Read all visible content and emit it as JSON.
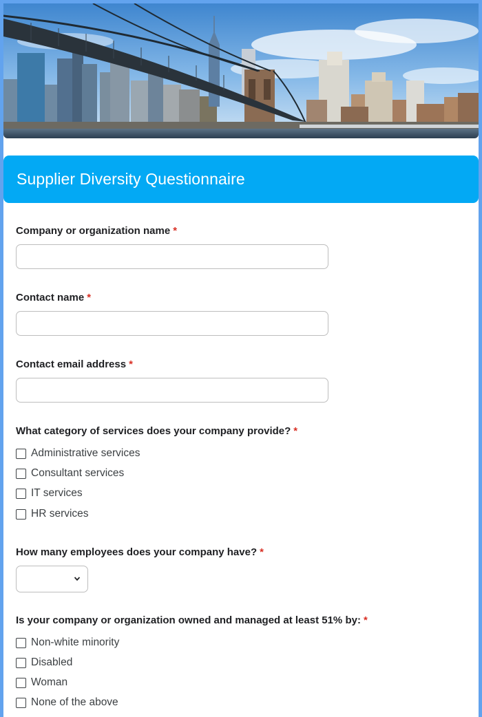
{
  "header": {
    "banner_icon": "city-skyline-bridge-image",
    "title": "Supplier Diversity Questionnaire",
    "accent_color": "#03a9f4"
  },
  "form": {
    "required_mark": "*",
    "company_name": {
      "label": "Company or organization name",
      "value": ""
    },
    "contact_name": {
      "label": "Contact name",
      "value": ""
    },
    "contact_email": {
      "label": "Contact email address",
      "value": ""
    },
    "services": {
      "label": "What category of services does your company provide?",
      "options": [
        "Administrative services",
        "Consultant services",
        "IT services",
        "HR services"
      ]
    },
    "employees": {
      "label": "How many employees does your company have?",
      "selected": ""
    },
    "ownership": {
      "label": "Is your company or organization owned and managed at least 51% by:",
      "options": [
        "Non-white minority",
        "Disabled",
        "Woman",
        "None of the above"
      ]
    }
  }
}
